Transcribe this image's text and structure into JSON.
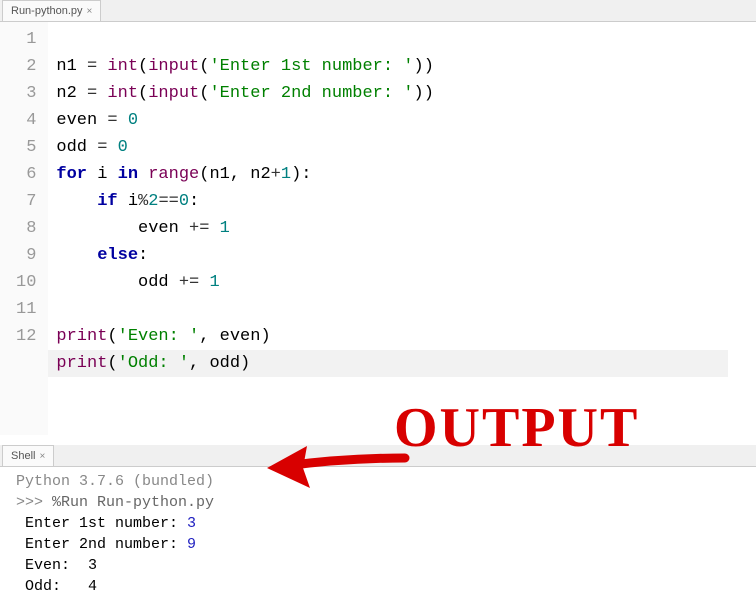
{
  "editor_tab": {
    "label": "Run-python.py"
  },
  "gutter": [
    "1",
    "2",
    "3",
    "4",
    "5",
    "6",
    "7",
    "8",
    "9",
    "10",
    "11",
    "12"
  ],
  "code": {
    "l1": {
      "a": "n1 ",
      "b": "=",
      "c": " ",
      "d": "int",
      "e": "(",
      "f": "input",
      "g": "(",
      "h": "'Enter 1st number: '",
      "i": "))"
    },
    "l2": {
      "a": "n2 ",
      "b": "=",
      "c": " ",
      "d": "int",
      "e": "(",
      "f": "input",
      "g": "(",
      "h": "'Enter 2nd number: '",
      "i": "))"
    },
    "l3": {
      "a": "even ",
      "b": "=",
      "c": " ",
      "d": "0"
    },
    "l4": {
      "a": "odd ",
      "b": "=",
      "c": " ",
      "d": "0"
    },
    "l5": {
      "a": "for",
      "b": " i ",
      "c": "in",
      "d": " ",
      "e": "range",
      "f": "(n1, n2",
      "g": "+",
      "h": "1",
      "i": "):"
    },
    "l6": {
      "a": "    ",
      "b": "if",
      "c": " i",
      "d": "%",
      "e": "2",
      "f": "==",
      "g": "0",
      "h": ":"
    },
    "l7": {
      "a": "        even ",
      "b": "+=",
      "c": " ",
      "d": "1"
    },
    "l8": {
      "a": "    ",
      "b": "else",
      "c": ":"
    },
    "l9": {
      "a": "        odd ",
      "b": "+=",
      "c": " ",
      "d": "1"
    },
    "l10": "",
    "l11": {
      "a": "print",
      "b": "(",
      "c": "'Even: '",
      "d": ", even)"
    },
    "l12": {
      "a": "print",
      "b": "(",
      "c": "'Odd: '",
      "d": ", odd)"
    }
  },
  "shell_tab": {
    "label": "Shell"
  },
  "shell": {
    "version": "Python 3.7.6 (bundled)",
    "prompt": ">>> ",
    "cmd": "%Run Run-python.py",
    "out1a": "Enter 1st number: ",
    "out1b": "3",
    "out2a": "Enter 2nd number: ",
    "out2b": "9",
    "out3": "Even:  3",
    "out4": "Odd:   4"
  },
  "annotation": {
    "label": "OUTPUT"
  }
}
